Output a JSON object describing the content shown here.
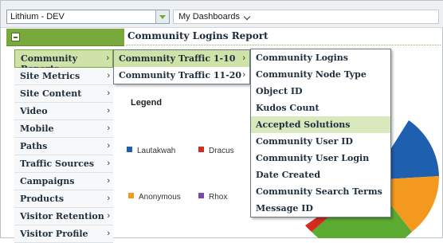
{
  "topbar": {
    "site_selector_value": "Lithium - DEV",
    "dashboards_label": "My Dashboards"
  },
  "report": {
    "title": "Community Logins Report",
    "legend_title": "Legend",
    "legend": [
      {
        "label": "Lautakwah",
        "color": "#1f5fb0"
      },
      {
        "label": "Dracus",
        "color": "#d52b1e"
      },
      {
        "label": "Anonymous",
        "color": "#f39a1e"
      },
      {
        "label": "Rhox",
        "color": "#7b4aa6"
      }
    ]
  },
  "sidebar": {
    "items": [
      {
        "label": "Community Reports"
      },
      {
        "label": "Site Metrics"
      },
      {
        "label": "Site Content"
      },
      {
        "label": "Video"
      },
      {
        "label": "Mobile"
      },
      {
        "label": "Paths"
      },
      {
        "label": "Traffic Sources"
      },
      {
        "label": "Campaigns"
      },
      {
        "label": "Products"
      },
      {
        "label": "Visitor Retention"
      },
      {
        "label": "Visitor Profile"
      }
    ]
  },
  "submenu": {
    "items": [
      {
        "label": "Community Traffic 1-10"
      },
      {
        "label": "Community Traffic 11-20"
      }
    ]
  },
  "reports_menu": {
    "items": [
      {
        "label": "Community Logins"
      },
      {
        "label": "Community Node Type"
      },
      {
        "label": "Object ID"
      },
      {
        "label": "Kudos Count"
      },
      {
        "label": "Accepted Solutions"
      },
      {
        "label": "Community User ID"
      },
      {
        "label": "Community User Login"
      },
      {
        "label": "Date Created"
      },
      {
        "label": "Community Search Terms"
      },
      {
        "label": "Message ID"
      }
    ]
  }
}
